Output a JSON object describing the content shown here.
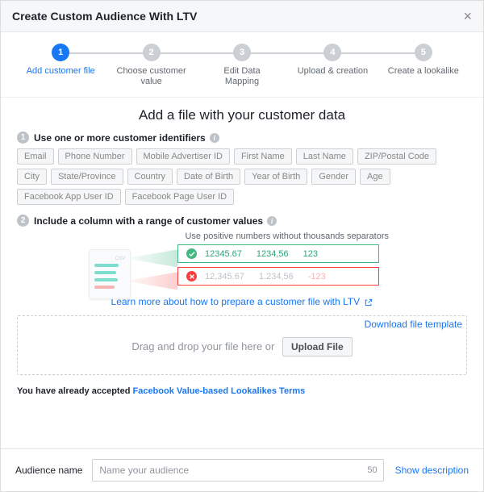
{
  "header": {
    "title": "Create Custom Audience With LTV"
  },
  "stepper": {
    "steps": [
      {
        "num": "1",
        "label": "Add customer file",
        "active": true
      },
      {
        "num": "2",
        "label": "Choose customer value",
        "active": false
      },
      {
        "num": "3",
        "label": "Edit Data Mapping",
        "active": false
      },
      {
        "num": "4",
        "label": "Upload & creation",
        "active": false
      },
      {
        "num": "5",
        "label": "Create a lookalike",
        "active": false
      }
    ]
  },
  "main": {
    "title": "Add a file with your customer data",
    "section1": {
      "num": "1",
      "title": "Use one or more customer identifiers",
      "chips": [
        "Email",
        "Phone Number",
        "Mobile Advertiser ID",
        "First Name",
        "Last Name",
        "ZIP/Postal Code",
        "City",
        "State/Province",
        "Country",
        "Date of Birth",
        "Year of Birth",
        "Gender",
        "Age",
        "Facebook App User ID",
        "Facebook Page User ID"
      ]
    },
    "section2": {
      "num": "2",
      "title": "Include a column with a range of customer values",
      "hint": "Use positive numbers without thousands separators",
      "good": [
        "12345.67",
        "1234,56",
        "123"
      ],
      "bad": [
        "12,345.67",
        "1.234,56",
        "-123"
      ]
    },
    "learn_link": "Learn more about how to prepare a customer file with LTV",
    "download_template": "Download file template",
    "drop_text": "Drag and drop your file here or",
    "upload_btn": "Upload File",
    "terms_prefix": "You have already accepted ",
    "terms_link": "Facebook Value-based Lookalikes Terms"
  },
  "footer": {
    "label": "Audience name",
    "placeholder": "Name your audience",
    "count": "50",
    "show_desc": "Show description"
  }
}
